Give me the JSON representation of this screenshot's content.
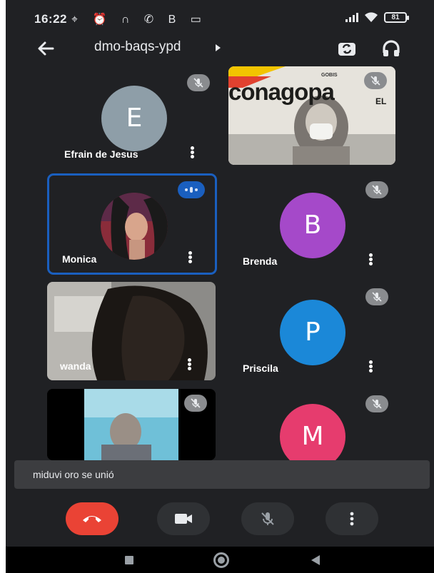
{
  "status_bar": {
    "time": "16:22",
    "left_icons": [
      "signal-off-icon",
      "alarm-icon",
      "headset-icon",
      "whatsapp-icon",
      "bitcoin-icon",
      "screen-record-icon"
    ],
    "left_glyphs": "⌖ ⏰ ∩ ✆ Β ▭",
    "battery": "81"
  },
  "top_bar": {
    "meeting_code": "dmo-baqs-ypd"
  },
  "participants": [
    {
      "name": "Efrain de Jesus",
      "initial": "E",
      "avatar_color": "#8e9ea8",
      "muted": true
    },
    {
      "name": "",
      "video": true,
      "muted": true,
      "video_text": "conagopa",
      "video_text_sub": "EL",
      "video_header": "GOBIS"
    },
    {
      "name": "Monica",
      "speaking": true,
      "photo_avatar": true
    },
    {
      "name": "Brenda",
      "initial": "B",
      "avatar_color": "#a549c9",
      "muted": true
    },
    {
      "name": "wanda",
      "video": true
    },
    {
      "name": "Priscila",
      "initial": "P",
      "avatar_color": "#1b88d8",
      "muted": true
    },
    {
      "name": "",
      "video": true,
      "muted": true
    },
    {
      "name": "",
      "initial": "M",
      "avatar_color": "#e63c6e",
      "muted": true
    }
  ],
  "toast": {
    "text": "miduvi oro se unió"
  },
  "colors": {
    "background": "#202124",
    "end_call": "#ea4335",
    "control": "#2f3134",
    "speaking_border": "#1a5fbf"
  }
}
